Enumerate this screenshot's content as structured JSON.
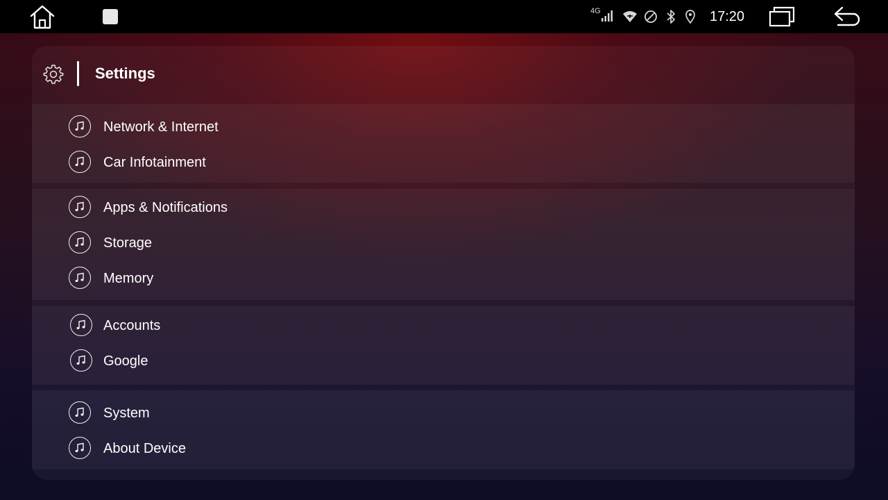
{
  "statusbar": {
    "network_type": "4G",
    "time": "17:20"
  },
  "icons": {
    "home": "home-icon",
    "recent_app": "app-thumbnail-icon",
    "signal": "cell-signal-icon",
    "wifi": "wifi-icon",
    "dnd": "do-not-disturb-icon",
    "bluetooth": "bluetooth-icon",
    "location": "location-pin-icon",
    "windows": "recent-windows-icon",
    "back": "back-arrow-icon",
    "settings": "gear-icon",
    "menu_item": "music-note-icon"
  },
  "header": {
    "title": "Settings"
  },
  "groups": [
    {
      "items": [
        {
          "label": "Network & Internet"
        },
        {
          "label": "Car Infotainment"
        }
      ]
    },
    {
      "items": [
        {
          "label": "Apps & Notifications"
        },
        {
          "label": "Storage"
        },
        {
          "label": "Memory"
        }
      ]
    },
    {
      "items": [
        {
          "label": "Accounts"
        },
        {
          "label": "Google"
        }
      ]
    },
    {
      "items": [
        {
          "label": "System"
        },
        {
          "label": "About Device"
        }
      ]
    }
  ],
  "colors": {
    "statusbar_bg": "#000000",
    "text": "#ffffff",
    "background_top": "#3a0a14",
    "background_bottom": "#0d0b26"
  }
}
